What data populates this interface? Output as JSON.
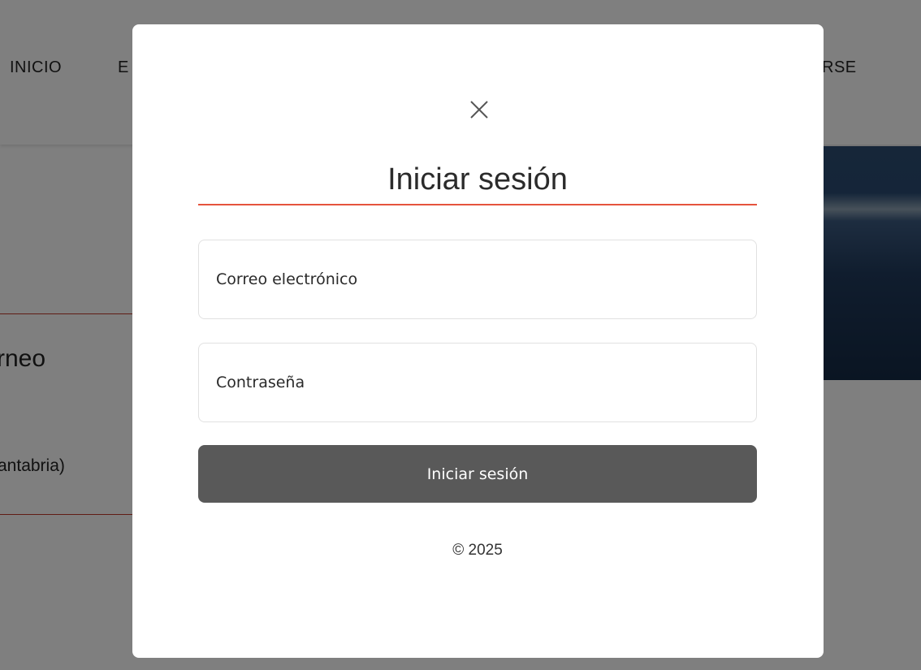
{
  "background": {
    "nav": {
      "item_inicio": "INICIO",
      "item_partial_left": "E",
      "item_partial_right": "RSE"
    },
    "content": {
      "heading_partial": "rneo",
      "location_partial": "antabria)"
    }
  },
  "modal": {
    "close_label": "×",
    "title": "Iniciar sesión",
    "email_placeholder": "Correo electrónico",
    "password_placeholder": "Contraseña",
    "submit_label": "Iniciar sesión",
    "footer": "© 2025"
  },
  "colors": {
    "accent": "#e5533d",
    "button_bg": "#595959",
    "overlay": "rgba(0,0,0,0.5)"
  }
}
